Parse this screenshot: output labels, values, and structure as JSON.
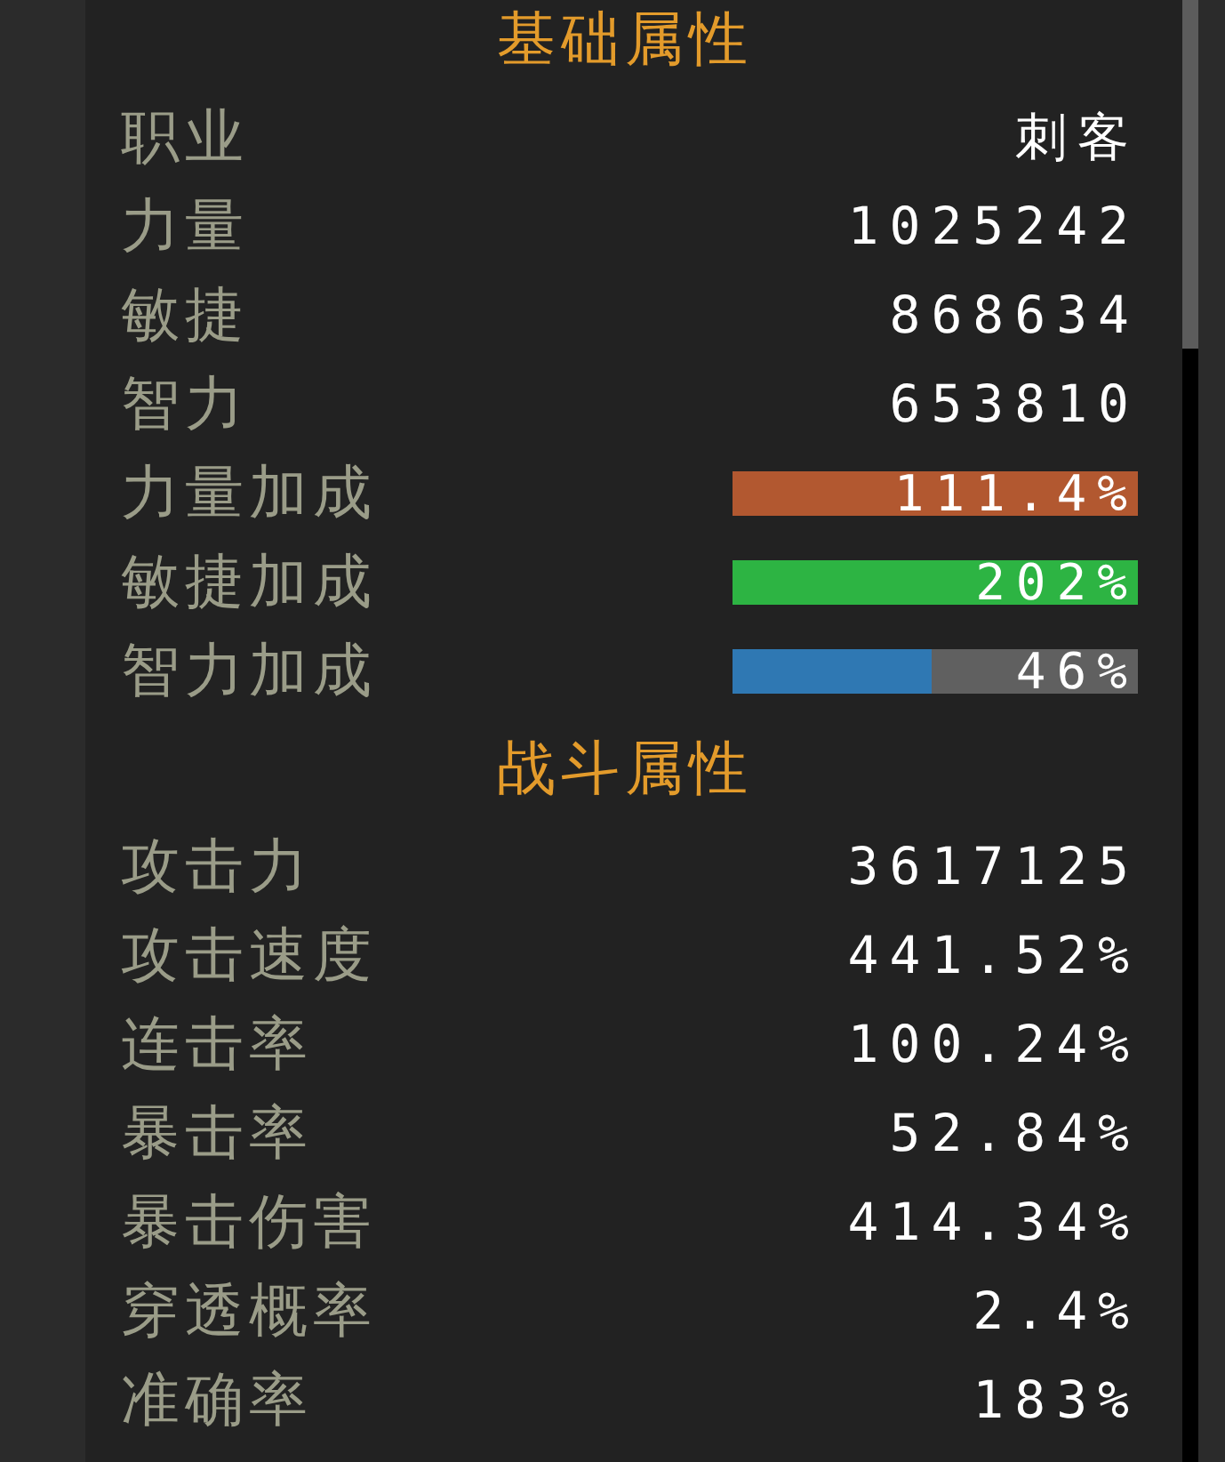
{
  "sections": [
    {
      "title": "基础属性",
      "rows": [
        {
          "kind": "text",
          "label": "职业",
          "value": "刺客"
        },
        {
          "kind": "text",
          "label": "力量",
          "value": "1025242"
        },
        {
          "kind": "text",
          "label": "敏捷",
          "value": "868634"
        },
        {
          "kind": "text",
          "label": "智力",
          "value": "653810"
        },
        {
          "kind": "bar",
          "label": "力量加成",
          "value": "111.4%",
          "level": 1,
          "color": "#b25830"
        },
        {
          "kind": "bar",
          "label": "敏捷加成",
          "value": "202%",
          "level": 1,
          "color": "#2db443"
        },
        {
          "kind": "bar",
          "label": "智力加成",
          "value": "46%",
          "level": 0.49,
          "color": "#2f78b3"
        }
      ]
    },
    {
      "title": "战斗属性",
      "rows": [
        {
          "kind": "text",
          "label": "攻击力",
          "value": "3617125"
        },
        {
          "kind": "text",
          "label": "攻击速度",
          "value": "441.52%"
        },
        {
          "kind": "text",
          "label": "连击率",
          "value": "100.24%"
        },
        {
          "kind": "text",
          "label": "暴击率",
          "value": "52.84%"
        },
        {
          "kind": "text",
          "label": "暴击伤害",
          "value": "414.34%"
        },
        {
          "kind": "text",
          "label": "穿透概率",
          "value": "2.4%"
        },
        {
          "kind": "text",
          "label": "准确率",
          "value": "183%"
        }
      ]
    }
  ]
}
